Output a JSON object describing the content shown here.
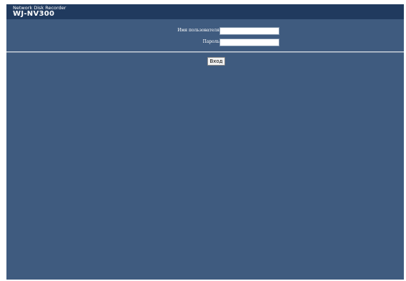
{
  "header": {
    "product_line": "Network Disk Recorder",
    "model": "WJ-NV300"
  },
  "login_form": {
    "username_label": "Имя пользователя",
    "username_value": "",
    "password_label": "Пароль",
    "password_value": "",
    "submit_label": "Вход"
  },
  "colors": {
    "header_background": "#203a5e",
    "page_background": "#3f5b7f",
    "divider": "#c7d0da"
  }
}
